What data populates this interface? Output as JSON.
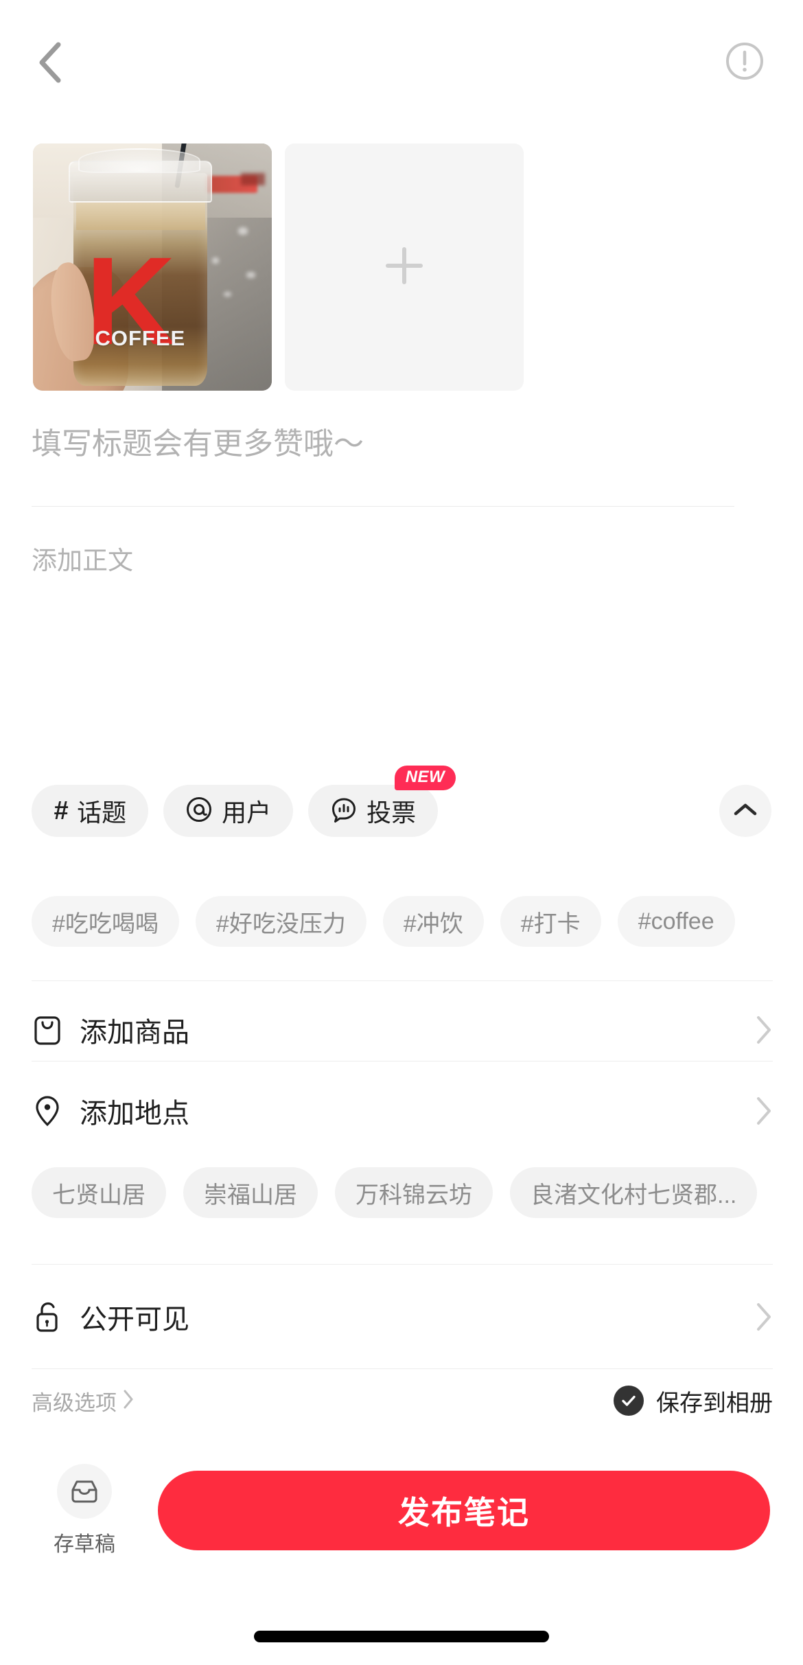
{
  "screen": {
    "name": "发布笔记",
    "accent_red": "#fe2c3f",
    "badge_red": "#fe2c55",
    "chip_bg": "#f2f2f2",
    "placeholder_gray": "#b2b2b2"
  },
  "navbar": {
    "back_icon": "chevron-left-icon",
    "info_icon": "exclamation-circle-icon"
  },
  "media": {
    "photo_alt": "K COFFEE 冰咖啡",
    "photo_brand_letter": "K",
    "photo_brand_word": "COFFEE",
    "add_icon": "plus-icon"
  },
  "editor": {
    "title_value": "",
    "title_placeholder": "填写标题会有更多赞哦～",
    "body_value": "",
    "body_placeholder": "添加正文"
  },
  "quick_actions": {
    "collapse_icon": "chevron-up-icon",
    "items": [
      {
        "icon": "hash-icon",
        "label": "话题",
        "badge": ""
      },
      {
        "icon": "at-icon",
        "label": "用户",
        "badge": ""
      },
      {
        "icon": "poll-icon",
        "label": "投票",
        "badge": "NEW"
      }
    ]
  },
  "tag_suggestions": [
    "#吃吃喝喝",
    "#好吃没压力",
    "#冲饮",
    "#打卡",
    "#coffee"
  ],
  "options": [
    {
      "icon": "goods-icon",
      "label": "添加商品",
      "arrow": "chevron-right-icon"
    },
    {
      "icon": "location-icon",
      "label": "添加地点",
      "arrow": "chevron-right-icon"
    },
    {
      "icon": "unlock-icon",
      "label": "公开可见",
      "arrow": "chevron-right-icon"
    }
  ],
  "place_suggestions": [
    "七贤山居",
    "崇福山居",
    "万科锦云坊",
    "良渚文化村七贤郡..."
  ],
  "advanced": {
    "label": "高级选项",
    "arrow": "chevron-right-icon",
    "save_to_album_label": "保存到相册",
    "save_to_album_checked": true,
    "check_icon": "check-icon"
  },
  "bottom": {
    "draft_icon": "inbox-icon",
    "draft_label": "存草稿",
    "publish_label": "发布笔记"
  }
}
